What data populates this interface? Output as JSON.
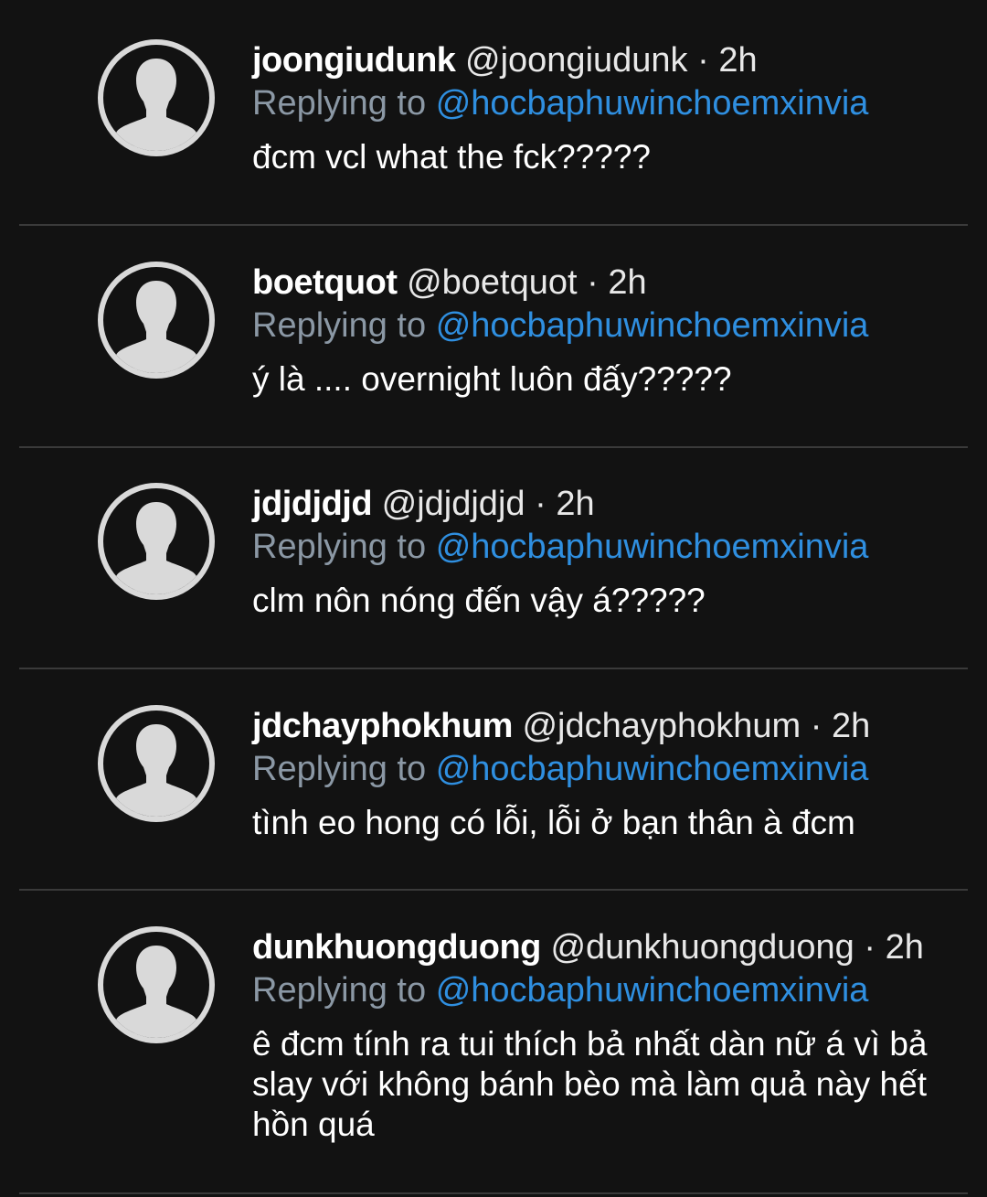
{
  "replies": [
    {
      "display_name": "joongiudunk",
      "handle": "@joongiudunk",
      "separator": "·",
      "time": "2h",
      "replying_prefix": "Replying to",
      "replying_to": "@hocbaphuwinchoemxinvia",
      "text": "đcm vcl what the fck?????"
    },
    {
      "display_name": "boetquot",
      "handle": "@boetquot",
      "separator": "·",
      "time": "2h",
      "replying_prefix": "Replying to",
      "replying_to": "@hocbaphuwinchoemxinvia",
      "text": "ý là .... overnight luôn đấy?????"
    },
    {
      "display_name": "jdjdjdjd",
      "handle": "@jdjdjdjd",
      "separator": "·",
      "time": "2h",
      "replying_prefix": "Replying to",
      "replying_to": "@hocbaphuwinchoemxinvia",
      "text": "clm nôn nóng đến vậy á?????"
    },
    {
      "display_name": "jdchayphokhum",
      "handle": "@jdchayphokhum",
      "separator": "·",
      "time": "2h",
      "replying_prefix": "Replying to",
      "replying_to": "@hocbaphuwinchoemxinvia",
      "text": "tình eo hong có lỗi, lỗi ở bạn thân à đcm"
    },
    {
      "display_name": "dunkhuongduong",
      "handle": "@dunkhuongduong",
      "separator": "·",
      "time": "2h",
      "replying_prefix": "Replying to",
      "replying_to": "@hocbaphuwinchoemxinvia",
      "text": "ê đcm tính ra tui thích bả nhất dàn nữ á vì bả slay với không bánh bèo mà làm quả này hết hồn quá"
    }
  ],
  "icons": {
    "avatar": "default-profile-avatar-icon"
  },
  "colors": {
    "background": "#121212",
    "mention": "#2f8fe0",
    "muted": "#8b98a5",
    "divider": "#3a3a3a"
  }
}
